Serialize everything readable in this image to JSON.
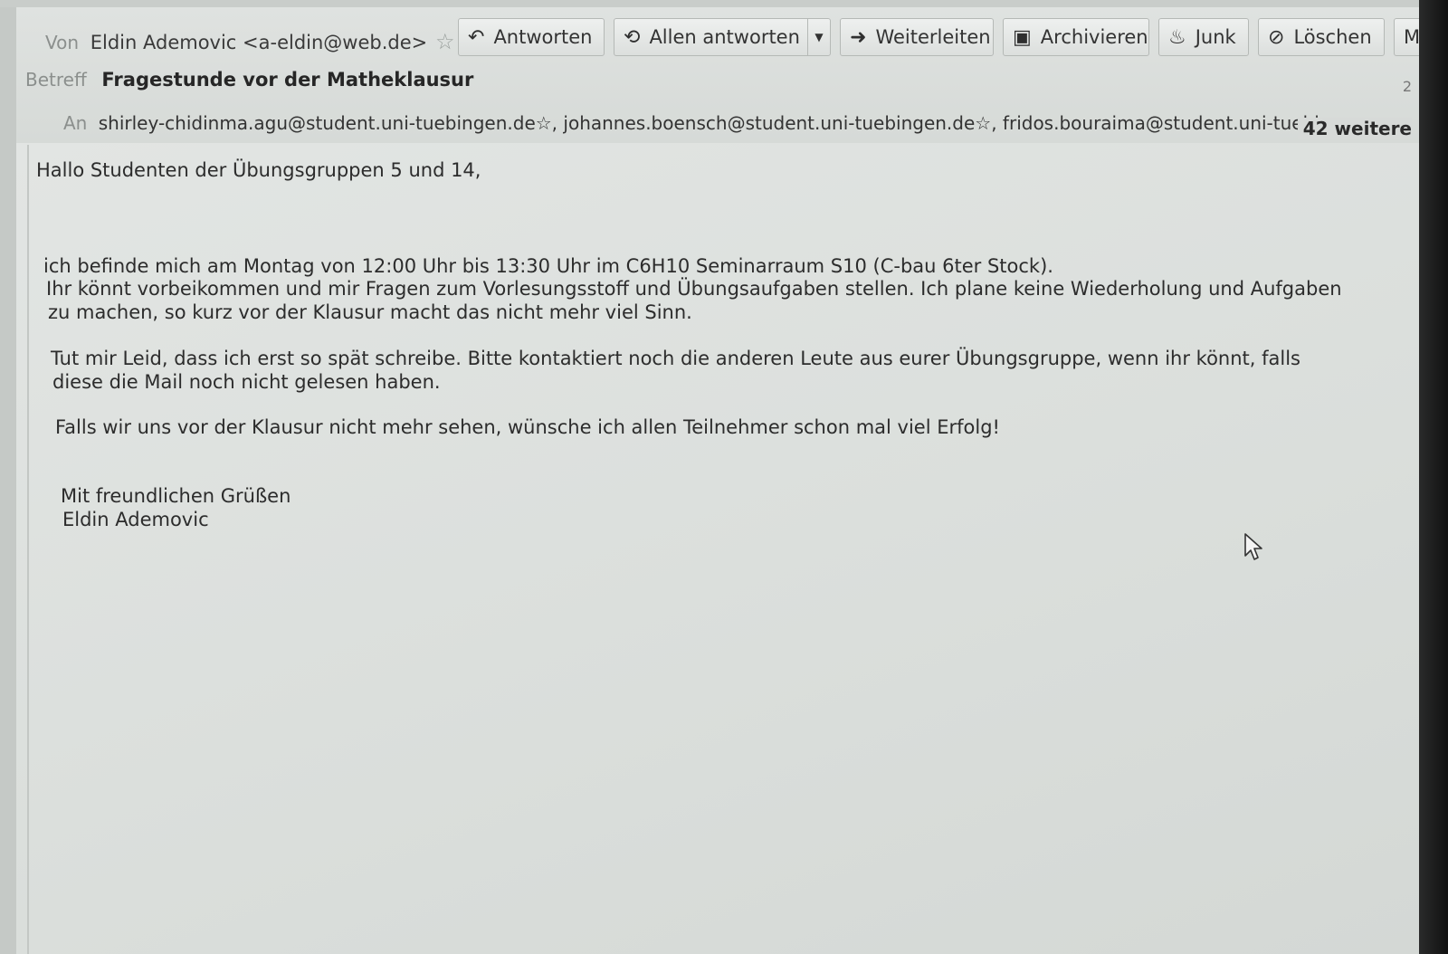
{
  "header": {
    "from_label": "Von",
    "from_value": "Eldin Ademovic <a-eldin@web.de>",
    "subject_label": "Betreff",
    "subject_value": "Fragestunde vor der Matheklausur",
    "subject_right": "2",
    "to_label": "An",
    "to_value": "shirley-chidinma.agu@student.uni-tuebingen.de☆, johannes.boensch@student.uni-tuebingen.de☆, fridos.bouraima@student.uni-tuebi",
    "more_recipients": "42 weitere"
  },
  "toolbar": {
    "reply": "Antworten",
    "reply_all": "Allen antworten",
    "forward": "Weiterleiten",
    "archive": "Archivieren",
    "junk": "Junk",
    "delete": "Löschen",
    "more": "Me"
  },
  "message": {
    "greeting": "Hallo Studenten der Übungsgruppen 5 und 14,",
    "p1_line1": "ich befinde mich am Montag von 12:00 Uhr bis 13:30 Uhr im C6H10 Seminarraum S10 (C-bau 6ter Stock).",
    "p1_line2": "Ihr könnt vorbeikommen und mir Fragen zum Vorlesungsstoff und Übungsaufgaben stellen. Ich plane keine Wiederholung und Aufgaben",
    "p1_line3": "zu machen, so kurz vor der Klausur macht das nicht mehr viel Sinn.",
    "p2_line1": "Tut mir Leid, dass ich erst so spät schreibe. Bitte kontaktiert noch die anderen Leute aus eurer Übungsgruppe, wenn ihr könnt, falls",
    "p2_line2": "diese die Mail noch nicht gelesen haben.",
    "p3": "Falls wir uns vor der Klausur nicht mehr sehen, wünsche ich allen Teilnehmer schon mal viel Erfolg!",
    "closing": "Mit freundlichen Grüßen",
    "signature": "Eldin Ademovic"
  }
}
